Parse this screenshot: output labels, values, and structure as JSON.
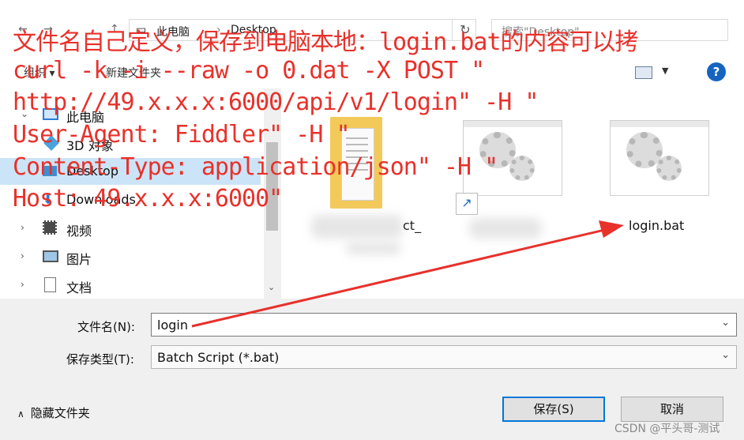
{
  "address_bar": {
    "back_icon": "arrow-left-icon",
    "forward_icon": "arrow-right-icon",
    "path": [
      "此电脑",
      "Desktop"
    ],
    "refresh_icon": "refresh-icon",
    "search_placeholder": "搜索\"Desktop\""
  },
  "toolbar": {
    "organize_label": "组织 ▾",
    "new_folder_label": "新建文件夹",
    "help_label": "?"
  },
  "nav_pane": {
    "items": [
      {
        "label": "此电脑",
        "icon": "computer-icon",
        "expanded": true,
        "selected": false
      },
      {
        "label": "3D 对象",
        "icon": "3d-objects-icon",
        "expanded": false,
        "selected": false
      },
      {
        "label": "Desktop",
        "icon": "desktop-icon",
        "expanded": false,
        "selected": true
      },
      {
        "label": "Downloads",
        "icon": "downloads-icon",
        "expanded": false,
        "selected": false
      },
      {
        "label": "视频",
        "icon": "video-icon",
        "expanded": false,
        "selected": false
      },
      {
        "label": "图片",
        "icon": "pictures-icon",
        "expanded": false,
        "selected": false
      },
      {
        "label": "文档",
        "icon": "documents-icon",
        "expanded": false,
        "selected": false
      }
    ]
  },
  "content": {
    "files": [
      {
        "label": "ct_",
        "icon": "folder-document-icon"
      },
      {
        "label": "",
        "icon": "batch-file-shortcut-icon"
      },
      {
        "label": "login.bat",
        "icon": "batch-file-icon"
      }
    ]
  },
  "form": {
    "filename_label": "文件名(N):",
    "filename_value": "login",
    "filetype_label": "保存类型(T):",
    "filetype_value": "Batch Script (*.bat)",
    "hide_folders_label": "隐藏文件夹",
    "save_label": "保存(S)",
    "cancel_label": "取消"
  },
  "annotation": {
    "color": "#e8312b",
    "lines": [
      "文件名自己定义，保存到电脑本地：login.bat的内容可以拷",
      "curl -k -i --raw -o 0.dat -X POST \"",
      "http://49.x.x.x:6000/api/v1/login\" -H \"",
      "User-Agent: Fiddler\" -H \"",
      "Content-Type: application/json\" -H \"",
      "Host: 49.x.x.x:6000\""
    ]
  },
  "watermark": "CSDN @平头哥-测试",
  "colors": {
    "selection": "#cce4f7",
    "accent": "#0078d7",
    "help": "#1565c0"
  }
}
